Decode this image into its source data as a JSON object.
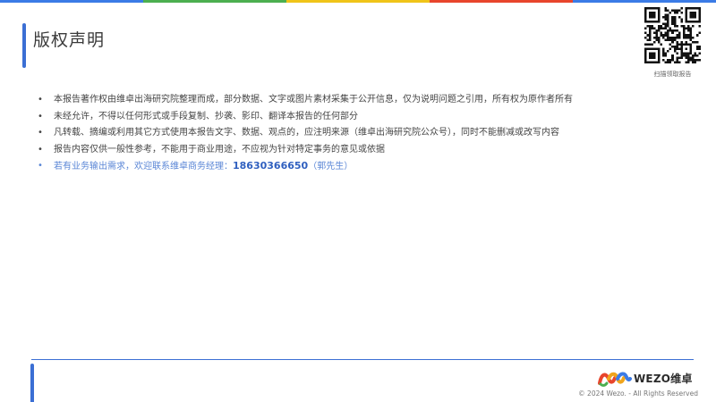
{
  "colors": {
    "accent": "#3b6fd4",
    "top_bar": [
      "#3b7be6",
      "#4caf50",
      "#f0c419",
      "#e8452c",
      "#3b7be6"
    ],
    "contact_text": "#5a86d6",
    "body_text": "#444444"
  },
  "header": {
    "title": "版权声明",
    "qr_icon": "qr-code-icon",
    "qr_caption": "扫描领取报告"
  },
  "content": {
    "bullet_glyph": "•",
    "bullets": [
      "本报告著作权由维卓出海研究院整理而成，部分数据、文字或图片素材采集于公开信息，仅为说明问题之引用，所有权为原作者所有",
      "未经允许，不得以任何形式或手段复制、抄袭、影印、翻译本报告的任何部分",
      "凡转载、摘编或利用其它方式使用本报告文字、数据、观点的，应注明来源（维卓出海研究院公众号），同时不能删减或改写内容",
      "报告内容仅供一般性参考，不能用于商业用途，不应视为针对特定事务的意见或依据"
    ],
    "contact": {
      "prefix": "若有业务输出需求，欢迎联系维卓商务经理：",
      "phone": "18630366650",
      "suffix": "（郭先生）"
    }
  },
  "footer": {
    "logo_icon": "wezo-logo-icon",
    "brand_name": "WEZO维卓",
    "copyright": "© 2024 Wezo. - All Rights Reserved"
  }
}
